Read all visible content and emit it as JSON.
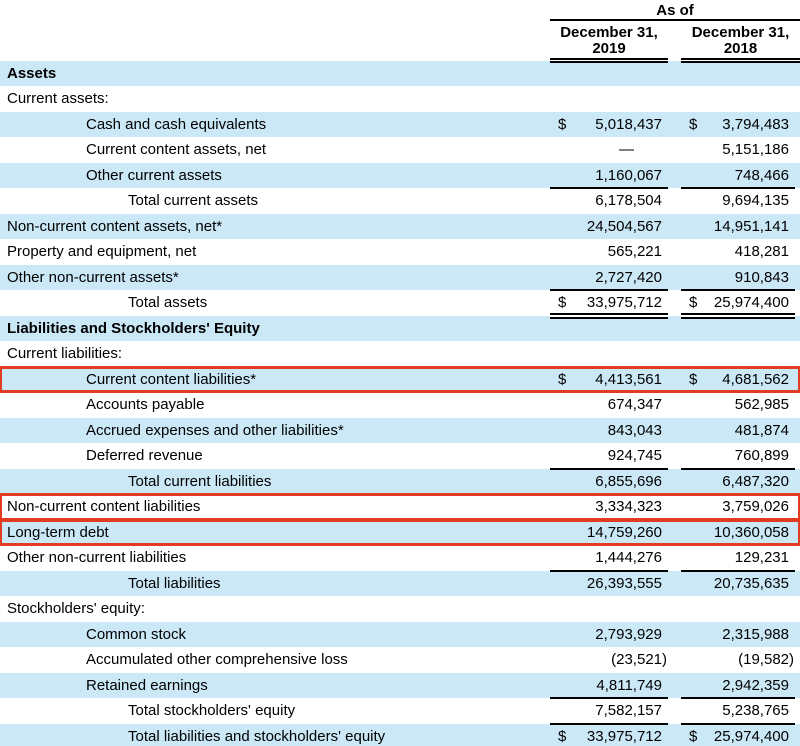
{
  "colors": {
    "row_stripe": "#cbe8f7",
    "highlight_border": "#e13b24",
    "rule": "#000000",
    "text": "#000000",
    "background": "#ffffff"
  },
  "currency_symbol": "$",
  "header": {
    "as_of": "As of",
    "period_2019": "December 31,\n2019",
    "period_2018": "December 31,\n2018"
  },
  "table": {
    "rows": [
      {
        "label": "Assets",
        "indent": 0,
        "bold": true,
        "stripe": true,
        "dollar": false,
        "v2019": "",
        "v2018": "",
        "rule": "none",
        "highlight": false
      },
      {
        "label": "Current assets:",
        "indent": 0,
        "bold": false,
        "stripe": false,
        "dollar": false,
        "v2019": "",
        "v2018": "",
        "rule": "none",
        "highlight": false
      },
      {
        "label": "Cash and cash equivalents",
        "indent": 1,
        "bold": false,
        "stripe": true,
        "dollar": true,
        "v2019": "5,018,437",
        "v2018": "3,794,483",
        "rule": "none",
        "highlight": false
      },
      {
        "label": "Current content assets, net",
        "indent": 1,
        "bold": false,
        "stripe": false,
        "dollar": false,
        "v2019": "—",
        "v2018": "5,151,186",
        "rule": "none",
        "highlight": false
      },
      {
        "label": "Other current assets",
        "indent": 1,
        "bold": false,
        "stripe": true,
        "dollar": false,
        "v2019": "1,160,067",
        "v2018": "748,466",
        "rule": "single",
        "highlight": false
      },
      {
        "label": "Total current assets",
        "indent": 2,
        "bold": false,
        "stripe": false,
        "dollar": false,
        "v2019": "6,178,504",
        "v2018": "9,694,135",
        "rule": "none",
        "highlight": false
      },
      {
        "label": "Non-current content assets, net*",
        "indent": 0,
        "bold": false,
        "stripe": true,
        "dollar": false,
        "v2019": "24,504,567",
        "v2018": "14,951,141",
        "rule": "none",
        "highlight": false
      },
      {
        "label": "Property and equipment, net",
        "indent": 0,
        "bold": false,
        "stripe": false,
        "dollar": false,
        "v2019": "565,221",
        "v2018": "418,281",
        "rule": "none",
        "highlight": false
      },
      {
        "label": "Other non-current assets*",
        "indent": 0,
        "bold": false,
        "stripe": true,
        "dollar": false,
        "v2019": "2,727,420",
        "v2018": "910,843",
        "rule": "single",
        "highlight": false
      },
      {
        "label": "Total assets",
        "indent": 2,
        "bold": false,
        "stripe": false,
        "dollar": true,
        "v2019": "33,975,712",
        "v2018": "25,974,400",
        "rule": "double",
        "highlight": false
      },
      {
        "label": "Liabilities and Stockholders' Equity",
        "indent": 0,
        "bold": true,
        "stripe": true,
        "dollar": false,
        "v2019": "",
        "v2018": "",
        "rule": "none",
        "highlight": false
      },
      {
        "label": "Current liabilities:",
        "indent": 0,
        "bold": false,
        "stripe": false,
        "dollar": false,
        "v2019": "",
        "v2018": "",
        "rule": "none",
        "highlight": false
      },
      {
        "label": "Current content liabilities*",
        "indent": 1,
        "bold": false,
        "stripe": true,
        "dollar": true,
        "v2019": "4,413,561",
        "v2018": "4,681,562",
        "rule": "none",
        "highlight": true
      },
      {
        "label": "Accounts payable",
        "indent": 1,
        "bold": false,
        "stripe": false,
        "dollar": false,
        "v2019": "674,347",
        "v2018": "562,985",
        "rule": "none",
        "highlight": false
      },
      {
        "label": "Accrued expenses and other liabilities*",
        "indent": 1,
        "bold": false,
        "stripe": true,
        "dollar": false,
        "v2019": "843,043",
        "v2018": "481,874",
        "rule": "none",
        "highlight": false
      },
      {
        "label": "Deferred revenue",
        "indent": 1,
        "bold": false,
        "stripe": false,
        "dollar": false,
        "v2019": "924,745",
        "v2018": "760,899",
        "rule": "single",
        "highlight": false
      },
      {
        "label": "Total current liabilities",
        "indent": 2,
        "bold": false,
        "stripe": true,
        "dollar": false,
        "v2019": "6,855,696",
        "v2018": "6,487,320",
        "rule": "none",
        "highlight": false
      },
      {
        "label": "Non-current content liabilities",
        "indent": 0,
        "bold": false,
        "stripe": false,
        "dollar": false,
        "v2019": "3,334,323",
        "v2018": "3,759,026",
        "rule": "none",
        "highlight": true
      },
      {
        "label": "Long-term debt",
        "indent": 0,
        "bold": false,
        "stripe": true,
        "dollar": false,
        "v2019": "14,759,260",
        "v2018": "10,360,058",
        "rule": "none",
        "highlight": true
      },
      {
        "label": "Other non-current liabilities",
        "indent": 0,
        "bold": false,
        "stripe": false,
        "dollar": false,
        "v2019": "1,444,276",
        "v2018": "129,231",
        "rule": "single",
        "highlight": false
      },
      {
        "label": "Total liabilities",
        "indent": 2,
        "bold": false,
        "stripe": true,
        "dollar": false,
        "v2019": "26,393,555",
        "v2018": "20,735,635",
        "rule": "none",
        "highlight": false
      },
      {
        "label": "Stockholders' equity:",
        "indent": 0,
        "bold": false,
        "stripe": false,
        "dollar": false,
        "v2019": "",
        "v2018": "",
        "rule": "none",
        "highlight": false
      },
      {
        "label": "Common stock",
        "indent": 1,
        "bold": false,
        "stripe": true,
        "dollar": false,
        "v2019": "2,793,929",
        "v2018": "2,315,988",
        "rule": "none",
        "highlight": false
      },
      {
        "label": "Accumulated other comprehensive loss",
        "indent": 1,
        "bold": false,
        "stripe": false,
        "dollar": false,
        "v2019": "(23,521)",
        "v2018": "(19,582)",
        "rule": "none",
        "highlight": false
      },
      {
        "label": "Retained earnings",
        "indent": 1,
        "bold": false,
        "stripe": true,
        "dollar": false,
        "v2019": "4,811,749",
        "v2018": "2,942,359",
        "rule": "single",
        "highlight": false
      },
      {
        "label": "Total stockholders' equity",
        "indent": 2,
        "bold": false,
        "stripe": false,
        "dollar": false,
        "v2019": "7,582,157",
        "v2018": "5,238,765",
        "rule": "single",
        "highlight": false
      },
      {
        "label": "Total liabilities and stockholders' equity",
        "indent": 2,
        "bold": false,
        "stripe": true,
        "dollar": true,
        "v2019": "33,975,712",
        "v2018": "25,974,400",
        "rule": "double",
        "highlight": false
      }
    ]
  }
}
